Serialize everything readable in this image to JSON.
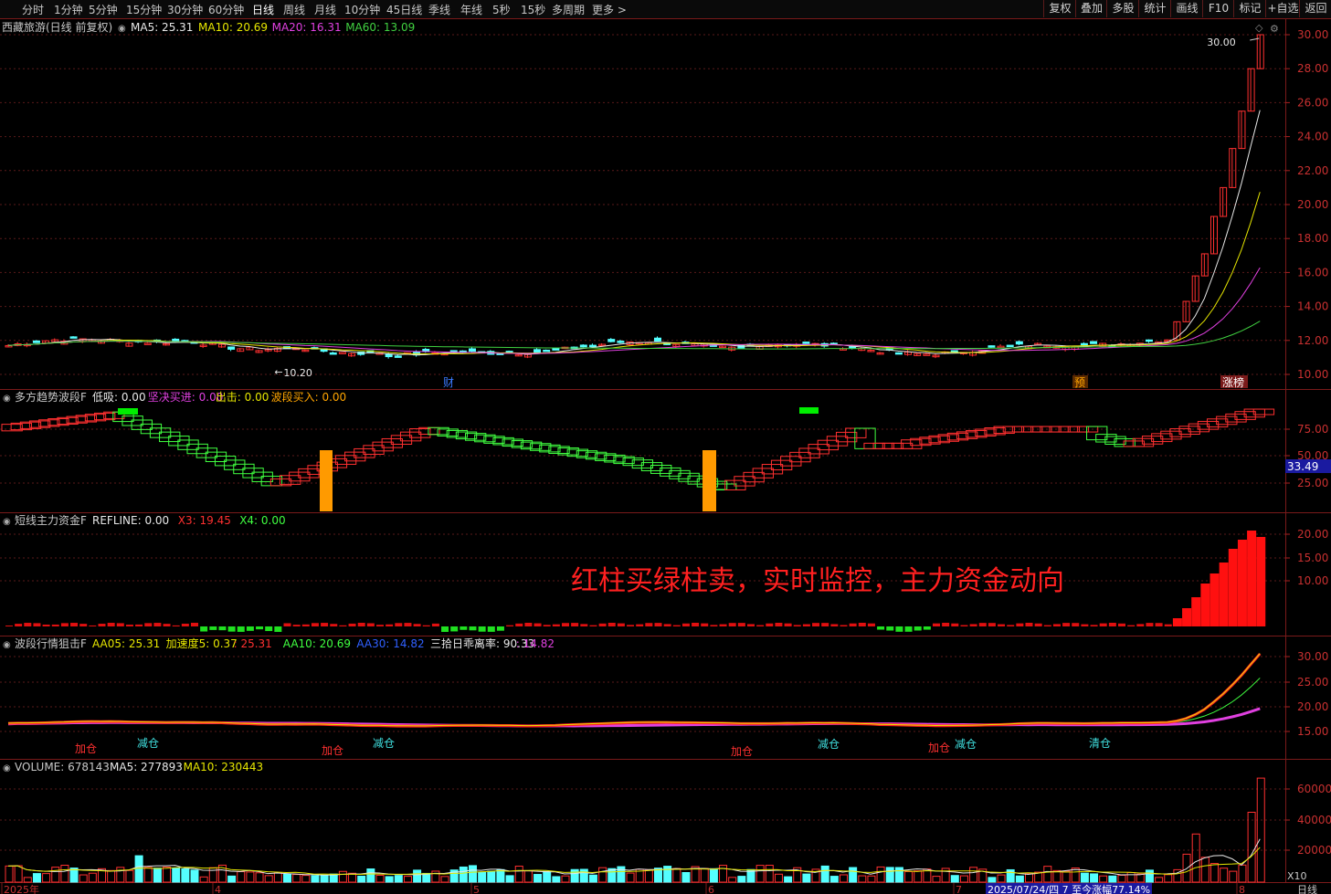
{
  "toolbar": {
    "timeframes": [
      "分时",
      "1分钟",
      "5分钟",
      "15分钟",
      "30分钟",
      "60分钟",
      "日线",
      "周线",
      "月线",
      "10分钟",
      "45日线",
      "季线",
      "年线",
      "5秒",
      "15秒",
      "多周期",
      "更多 >"
    ],
    "active_index": 6,
    "right_buttons": [
      "复权",
      "叠加",
      "多股",
      "统计",
      "画线",
      "F10",
      "标记",
      "+自选",
      "返回"
    ]
  },
  "main_panel": {
    "title": "西藏旅游(日线 前复权)",
    "indicators": [
      {
        "label": "MA5: 25.31",
        "color": "#e8e8e8"
      },
      {
        "label": "MA10: 20.69",
        "color": "#e6e600"
      },
      {
        "label": "MA20: 16.31",
        "color": "#e040e0"
      },
      {
        "label": "MA60: 13.09",
        "color": "#40d040"
      }
    ],
    "y_ticks": [
      "30.00",
      "28.00",
      "26.00",
      "24.00",
      "22.00",
      "20.00",
      "18.00",
      "16.00",
      "14.00",
      "12.00",
      "10.00"
    ],
    "high_label": "30.00",
    "low_label": "10.20",
    "markers": [
      {
        "text": "财",
        "color": "#3a7aff",
        "bg": "none"
      },
      {
        "text": "预",
        "color": "#ffa500",
        "bg": "#5a2a00"
      },
      {
        "text": "涨榜",
        "color": "#ffffff",
        "bg": "#7a1a1a"
      }
    ]
  },
  "panel2": {
    "name": "多方趋势波段F",
    "items": [
      {
        "label": "低吸: 0.00",
        "color": "#e8e8e8"
      },
      {
        "label": "坚决买进: 0.00",
        "color": "#e040e0"
      },
      {
        "label": "出击: 0.00",
        "color": "#e6e600"
      },
      {
        "label": "波段买入: 0.00",
        "color": "#ffa500"
      }
    ],
    "y_ticks": [
      "75.00",
      "50.00",
      "25.00"
    ],
    "current_value": "33.49"
  },
  "panel3": {
    "name": "短线主力资金F",
    "items": [
      {
        "label": "REFLINE: 0.00",
        "color": "#e8e8e8"
      },
      {
        "label": "X3: 19.45",
        "color": "#ff3030"
      },
      {
        "label": "X4: 0.00",
        "color": "#40ff40"
      }
    ],
    "y_ticks": [
      "20.00",
      "15.00",
      "10.00"
    ],
    "annotation": "红柱买绿柱卖，实时监控，主力资金动向"
  },
  "panel4": {
    "name": "波段行情狙击F",
    "items": [
      {
        "label": "AA05: 25.31",
        "color": "#e6e600"
      },
      {
        "label": "加速度5: 0.37",
        "color": "#e6e600"
      },
      {
        "label": ": 25.31",
        "color": "#ff3030"
      },
      {
        "label": "AA10: 20.69",
        "color": "#40ff40"
      },
      {
        "label": "AA30: 14.82",
        "color": "#3060ff"
      },
      {
        "label": "三拾日乖离率: 90.33",
        "color": "#e8e8e8"
      },
      {
        "label": ": 14.82",
        "color": "#e040e0"
      }
    ],
    "y_ticks": [
      "30.00",
      "25.00",
      "20.00",
      "15.00"
    ],
    "signals": [
      {
        "text": "加仓",
        "color": "#ff3030"
      },
      {
        "text": "减仓",
        "color": "#40e0e0"
      },
      {
        "text": "加仓",
        "color": "#ff3030"
      },
      {
        "text": "减仓",
        "color": "#40e0e0"
      },
      {
        "text": "加仓",
        "color": "#ff3030"
      },
      {
        "text": "减仓",
        "color": "#40e0e0"
      },
      {
        "text": "加仓",
        "color": "#ff3030"
      },
      {
        "text": "减仓",
        "color": "#40e0e0"
      },
      {
        "text": "清仓",
        "color": "#40e0e0"
      }
    ]
  },
  "panel5": {
    "name": "VOLUME: 678143",
    "items": [
      {
        "label": "MA5: 277893",
        "color": "#e8e8e8"
      },
      {
        "label": "MA10: 230443",
        "color": "#e6e600"
      }
    ],
    "y_ticks": [
      "60000",
      "40000",
      "20000"
    ],
    "unit": "X10"
  },
  "x_axis": {
    "labels": [
      "2025年",
      "4",
      "5",
      "6",
      "7",
      "8"
    ],
    "status": "2025/07/24/四 7 至今涨幅77.14%",
    "period": "日线"
  },
  "chart_data": {
    "type": "candlestick",
    "title": "西藏旅游(日线 前复权)",
    "ylim": [
      10.0,
      30.0
    ],
    "max_price": 30.0,
    "min_price": 10.2,
    "last_closes": [
      13.1,
      14.3,
      15.8,
      17.1,
      19.3,
      21.0,
      23.3,
      25.5,
      28.0,
      30.0
    ],
    "series": [
      {
        "name": "MA5",
        "last": 25.31
      },
      {
        "name": "MA10",
        "last": 20.69
      },
      {
        "name": "MA20",
        "last": 16.31
      },
      {
        "name": "MA60",
        "last": 13.09
      }
    ]
  },
  "colors": {
    "up": "#ff3030",
    "down": "#54ffff",
    "grid": "#5a1a1a",
    "ma5": "#e8e8e8",
    "ma10": "#e6e600",
    "ma20": "#e040e0",
    "ma60": "#40d040"
  }
}
